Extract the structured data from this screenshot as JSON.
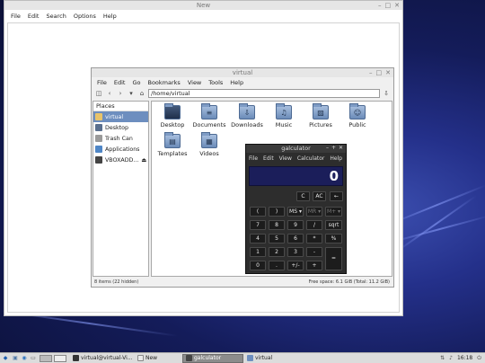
{
  "desktop": {},
  "new_window": {
    "title": "New",
    "menu": [
      "File",
      "Edit",
      "Search",
      "Options",
      "Help"
    ]
  },
  "file_manager": {
    "title": "virtual",
    "menu": [
      "File",
      "Edit",
      "Go",
      "Bookmarks",
      "View",
      "Tools",
      "Help"
    ],
    "path": "/home/virtual",
    "sidebar": {
      "header": "Places",
      "items": [
        "virtual",
        "Desktop",
        "Trash Can",
        "Applications",
        "VBOXADD..."
      ]
    },
    "items": [
      "Desktop",
      "Documents",
      "Downloads",
      "Music",
      "Pictures",
      "Public",
      "Templates",
      "Videos"
    ],
    "status_left": "8 items (22 hidden)",
    "status_right": "Free space: 6.1 GiB (Total: 11.2 GiB)"
  },
  "calculator": {
    "title": "galculator",
    "menu": [
      "File",
      "Edit",
      "View",
      "Calculator",
      "Help"
    ],
    "display": "0",
    "top_buttons": [
      "C",
      "AC",
      "←"
    ],
    "rows": [
      [
        "(",
        ")",
        "MS ▾",
        "MR ▾",
        "M+ ▾"
      ],
      [
        "7",
        "8",
        "9",
        "/",
        "sqrt"
      ],
      [
        "4",
        "5",
        "6",
        "*",
        "%"
      ],
      [
        "1",
        "2",
        "3",
        "-",
        ""
      ],
      [
        "0",
        ".",
        "+/-",
        "+",
        ""
      ]
    ],
    "equals": "="
  },
  "taskbar": {
    "tasks": [
      "virtual@virtual-Vi...",
      "New",
      "galculator",
      "virtual"
    ],
    "clock": "16:18"
  },
  "colors": {
    "selection": "#6d8ebf",
    "calc_display": "#1b1e5a",
    "desktop": "#1a2470"
  }
}
